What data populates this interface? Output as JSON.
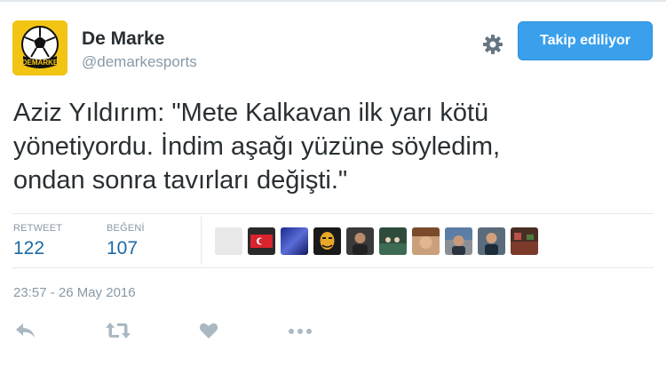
{
  "user": {
    "display_name": "De Marke",
    "handle": "@demarkesports",
    "avatar_label": "DEMARKE"
  },
  "header": {
    "settings_icon": "gear-icon",
    "follow_label": "Takip ediliyor",
    "accent_color": "#3aa0ec"
  },
  "tweet": {
    "lines": [
      "Aziz Yıldırım: \"Mete Kalkavan ilk yarı kötü",
      "yönetiyordu. İndim aşağı yüzüne söyledim,",
      "ondan sonra tavırları değişti.\""
    ]
  },
  "stats": {
    "retweet_label": "RETWEET",
    "retweet_count": "122",
    "like_label": "BEĞENİ",
    "like_count": "107"
  },
  "likers_count_shown": 10,
  "timestamp": "23:57 - 26 May 2016",
  "actions": [
    "reply-icon",
    "retweet-icon",
    "like-icon",
    "more-icon"
  ]
}
